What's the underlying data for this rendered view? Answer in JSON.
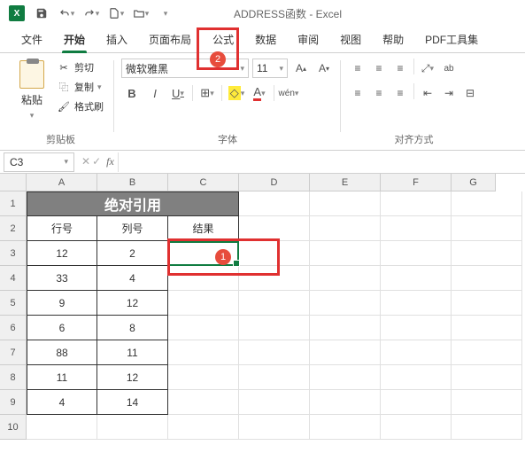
{
  "app": {
    "title": "ADDRESS函数 - Excel"
  },
  "qat": {
    "save": "保存",
    "undo": "撤销",
    "redo": "重做",
    "new": "新建",
    "open": "打开"
  },
  "tabs": [
    "文件",
    "开始",
    "插入",
    "页面布局",
    "公式",
    "数据",
    "审阅",
    "视图",
    "帮助",
    "PDF工具集"
  ],
  "active_tab": "开始",
  "annotated_tab": "公式",
  "ribbon": {
    "clipboard": {
      "label": "剪贴板",
      "paste": "粘贴",
      "cut": "剪切",
      "copy": "复制",
      "format_painter": "格式刷"
    },
    "font": {
      "label": "字体",
      "name": "微软雅黑",
      "size": "11",
      "bold": "B",
      "italic": "I",
      "underline": "U"
    },
    "align": {
      "label": "对齐方式"
    }
  },
  "namebox": "C3",
  "columns": [
    "A",
    "B",
    "C",
    "D",
    "E",
    "F",
    "G"
  ],
  "rows": [
    "1",
    "2",
    "3",
    "4",
    "5",
    "6",
    "7",
    "8",
    "9",
    "10"
  ],
  "sheet": {
    "title": "绝对引用",
    "headers": [
      "行号",
      "列号",
      "结果"
    ],
    "data": [
      [
        "12",
        "2",
        ""
      ],
      [
        "33",
        "4",
        ""
      ],
      [
        "9",
        "12",
        ""
      ],
      [
        "6",
        "8",
        ""
      ],
      [
        "88",
        "11",
        ""
      ],
      [
        "11",
        "12",
        ""
      ],
      [
        "4",
        "14",
        ""
      ]
    ]
  },
  "annotations": {
    "badge1": "1",
    "badge2": "2"
  },
  "colors": {
    "accent": "#107c41",
    "highlight": "#e03030",
    "badge": "#e74c3c",
    "header_bg": "#808080"
  }
}
